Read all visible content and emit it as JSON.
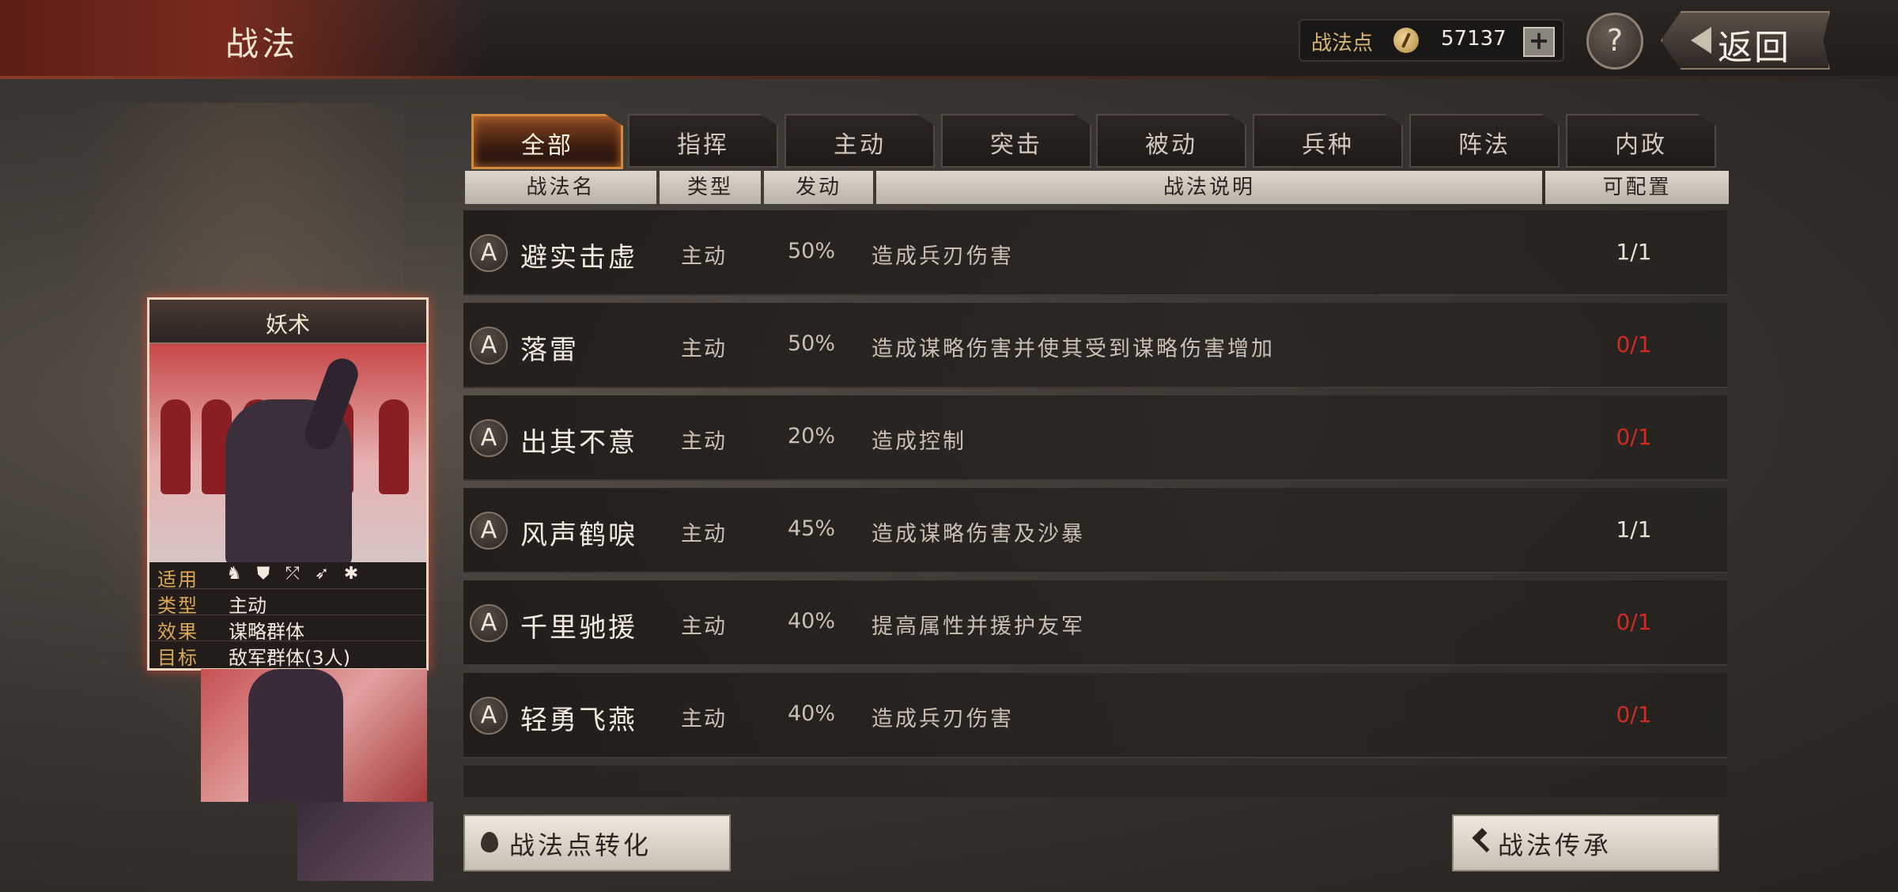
{
  "header": {
    "title": "战法",
    "points_label": "战法点",
    "points_value": "57137",
    "plus_label": "+",
    "help_label": "?",
    "back_label": "返回"
  },
  "tabs": [
    {
      "label": "全部",
      "active": true
    },
    {
      "label": "指挥",
      "active": false
    },
    {
      "label": "主动",
      "active": false
    },
    {
      "label": "突击",
      "active": false
    },
    {
      "label": "被动",
      "active": false
    },
    {
      "label": "兵种",
      "active": false
    },
    {
      "label": "阵法",
      "active": false
    },
    {
      "label": "内政",
      "active": false
    }
  ],
  "table": {
    "headers": {
      "name": "战法名",
      "type": "类型",
      "rate": "发动",
      "desc": "战法说明",
      "avail": "可配置"
    },
    "rows": [
      {
        "grade": "A",
        "name": "避实击虚",
        "type": "主动",
        "rate": "50%",
        "desc": "造成兵刃伤害",
        "avail": "1/1"
      },
      {
        "grade": "A",
        "name": "落雷",
        "type": "主动",
        "rate": "50%",
        "desc": "造成谋略伤害并使其受到谋略伤害增加",
        "avail": "0/1"
      },
      {
        "grade": "A",
        "name": "出其不意",
        "type": "主动",
        "rate": "20%",
        "desc": "造成控制",
        "avail": "0/1"
      },
      {
        "grade": "A",
        "name": "风声鹤唳",
        "type": "主动",
        "rate": "45%",
        "desc": "造成谋略伤害及沙暴",
        "avail": "1/1"
      },
      {
        "grade": "A",
        "name": "千里驰援",
        "type": "主动",
        "rate": "40%",
        "desc": "提高属性并援护友军",
        "avail": "0/1"
      },
      {
        "grade": "A",
        "name": "轻勇飞燕",
        "type": "主动",
        "rate": "40%",
        "desc": "造成兵刃伤害",
        "avail": "0/1"
      }
    ]
  },
  "card": {
    "title": "妖术",
    "applies_label": "适用",
    "type_label": "类型",
    "type_value": "主动",
    "effect_label": "效果",
    "effect_value": "谋略群体",
    "target_label": "目标",
    "target_value": "敌军群体(3人)",
    "troop_icons": [
      "cavalry-icon",
      "shield-icon",
      "bow-icon",
      "spear-icon",
      "wheel-icon"
    ]
  },
  "buttons": {
    "convert_label": "战法点转化",
    "inherit_label": "战法传承"
  },
  "colors": {
    "accent_orange": "#d48a3c",
    "unavailable_red": "#d42a22",
    "title_band": "#7a2a1d"
  }
}
